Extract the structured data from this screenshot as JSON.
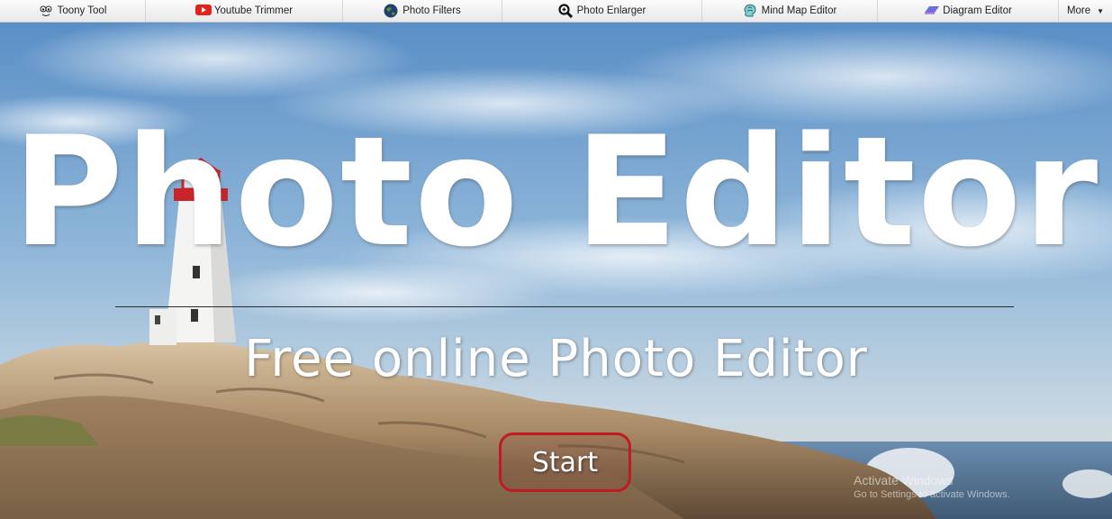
{
  "nav": {
    "items": [
      {
        "label": "Toony Tool",
        "icon": "toony-face-icon"
      },
      {
        "label": "Youtube Trimmer",
        "icon": "youtube-icon"
      },
      {
        "label": "Photo Filters",
        "icon": "globe-icon"
      },
      {
        "label": "Photo Enlarger",
        "icon": "magnifier-icon"
      },
      {
        "label": "Mind Map Editor",
        "icon": "brain-icon"
      },
      {
        "label": "Diagram Editor",
        "icon": "eraser-icon"
      }
    ],
    "more_label": "More"
  },
  "hero": {
    "title": "Photo Editor",
    "subtitle": "Free online Photo Editor",
    "start_label": "Start"
  },
  "watermark": {
    "line1": "Activate Windows",
    "line2": "Go to Settings to activate Windows."
  },
  "colors": {
    "start_border": "#c11a22",
    "sky_top": "#5a8fc6",
    "sea": "#4f6f8c"
  }
}
